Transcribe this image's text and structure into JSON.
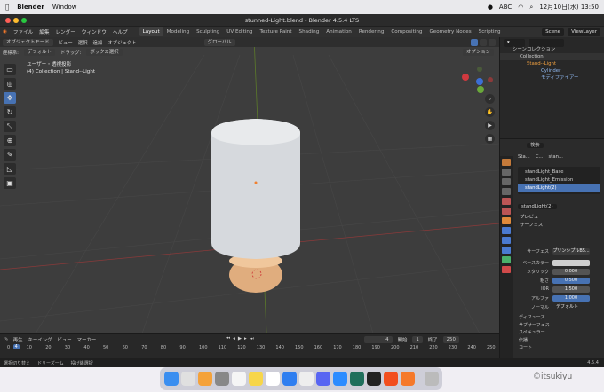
{
  "menubar": {
    "app": "Blender",
    "items": [
      "Window"
    ],
    "input": "ABC",
    "clock": "12月10日(水) 13:50"
  },
  "window": {
    "title": "stunned-Light.blend - Blender 4.5.4 LTS"
  },
  "topmenu": {
    "items": [
      "ファイル",
      "編集",
      "レンダー",
      "ウィンドウ",
      "ヘルプ"
    ],
    "tabs": [
      "Layout",
      "Modeling",
      "Sculpting",
      "UV Editing",
      "Texture Paint",
      "Shading",
      "Animation",
      "Rendering",
      "Compositing",
      "Geometry Nodes",
      "Scripting"
    ],
    "scene": "Scene",
    "view_layer": "ViewLayer"
  },
  "viewport_header": {
    "mode": "オブジェクトモード",
    "menus": [
      "ビュー",
      "選択",
      "追加",
      "オブジェクト"
    ],
    "transform": "グローバル",
    "orientation_label": "座標系:",
    "orientation": "デフォルト",
    "drag_label": "ドラッグ:",
    "drag": "ボックス選択",
    "options": "オプション"
  },
  "viewport": {
    "info_line1": "ユーザー・透視投影",
    "info_line2": "(4) Collection | Stand--Light"
  },
  "outliner": {
    "search_placeholder": "",
    "rows": [
      "シーンコレクション",
      "Collection",
      "Stand--Light",
      "Cylinder",
      "モディファイアー"
    ]
  },
  "properties": {
    "search_placeholder": "検索",
    "breadcrumb": [
      "Sta...",
      "C...",
      "stan..."
    ],
    "materials": [
      "standLight_Base",
      "standLight_Emission",
      "standLight(2)"
    ],
    "material_name": "standLight(2)",
    "sections": {
      "preview": "プレビュー",
      "surface_header": "サーフェス",
      "surface_label": "サーフェス",
      "surface_value": "プリンシプルBS...",
      "fields": [
        {
          "label": "ベースカラー",
          "value": ""
        },
        {
          "label": "メタリック",
          "value": "0.000"
        },
        {
          "label": "粗さ",
          "value": "0.500"
        },
        {
          "label": "IOR",
          "value": "1.500"
        },
        {
          "label": "アルファ",
          "value": "1.000"
        },
        {
          "label": "ノーマル",
          "value": "デフォルト"
        }
      ],
      "subsections": [
        "ディフューズ",
        "サブサーフェス",
        "スペキュラー",
        "伝播",
        "コート"
      ]
    }
  },
  "timeline": {
    "menus": [
      "再生",
      "キーイング",
      "ビュー",
      "マーカー"
    ],
    "current_frame": "4",
    "start_label": "開始",
    "start": "1",
    "end_label": "終了",
    "end": "250",
    "ruler": [
      "0",
      "10",
      "20",
      "30",
      "40",
      "50",
      "60",
      "70",
      "80",
      "90",
      "100",
      "110",
      "120",
      "130",
      "140",
      "150",
      "160",
      "170",
      "180",
      "190",
      "200",
      "210",
      "220",
      "230",
      "240",
      "250"
    ]
  },
  "statusbar": {
    "items": [
      "選択切り替え",
      "ドリーズーム",
      "投げ縄選択"
    ],
    "version": "4.5.4"
  },
  "watermark": "©itsukiyu",
  "colors": {
    "accent": "#4772b3",
    "viewport_bg": "#3d3d3d",
    "cup": "#d8dadd",
    "base": "#e8b98a"
  }
}
